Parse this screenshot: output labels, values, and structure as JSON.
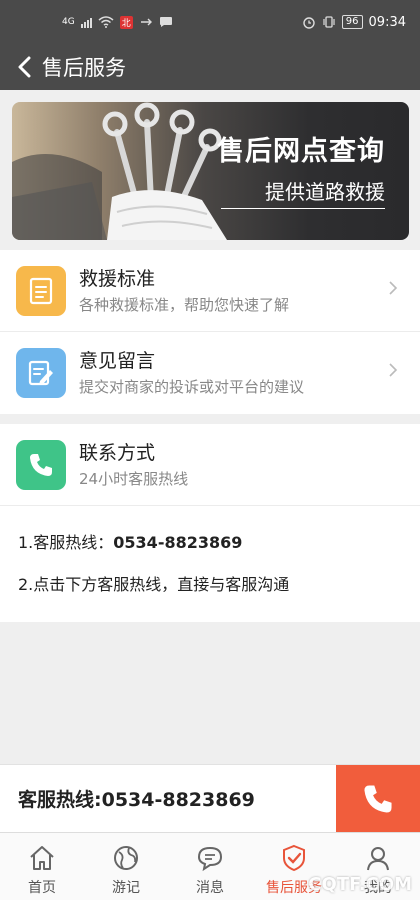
{
  "status_bar": {
    "network": "4G",
    "badge": "北",
    "battery": "96",
    "time": "09:34"
  },
  "header": {
    "title": "售后服务"
  },
  "banner": {
    "title": "售后网点查询",
    "subtitle": "提供道路救援"
  },
  "menu": {
    "items": [
      {
        "title": "救援标准",
        "desc": "各种救援标准，帮助您快速了解",
        "icon": "document-icon",
        "color": "#f7b84b"
      },
      {
        "title": "意见留言",
        "desc": "提交对商家的投诉或对平台的建议",
        "icon": "edit-note-icon",
        "color": "#6fb6ec"
      }
    ]
  },
  "contact": {
    "title": "联系方式",
    "desc": "24小时客服热线",
    "icon": "phone-icon",
    "color": "#3fc488",
    "line1_prefix": "1.客服热线：",
    "line1_number": "0534-8823869",
    "line2": "2.点击下方客服热线，直接与客服沟通"
  },
  "hotline": {
    "text": "客服热线:0534-8823869",
    "button_color": "#f15d3c"
  },
  "tabs": [
    {
      "label": "首页",
      "icon": "home-icon"
    },
    {
      "label": "游记",
      "icon": "globe-icon"
    },
    {
      "label": "消息",
      "icon": "chat-icon"
    },
    {
      "label": "售后服务",
      "icon": "shield-check-icon",
      "active": true
    },
    {
      "label": "我的",
      "icon": "user-icon"
    }
  ],
  "watermark": "CQTF.COM",
  "colors": {
    "header_bg": "#4a4a4a",
    "accent": "#e8543a"
  }
}
